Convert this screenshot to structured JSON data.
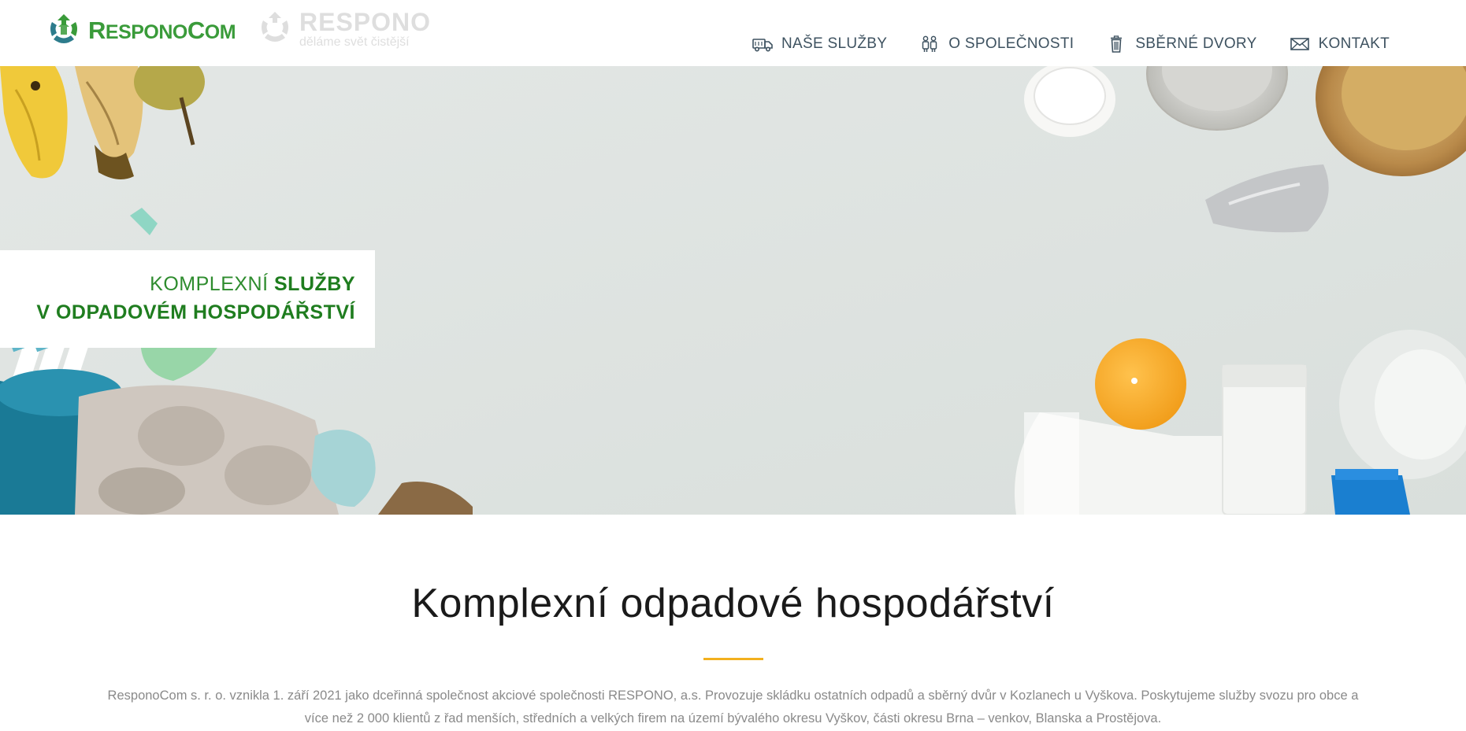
{
  "header": {
    "logo_prefix": "R",
    "logo_mid": "ESPONO",
    "logo_c": "C",
    "logo_suffix": "OM",
    "partner_logo_name": "RESPONO",
    "partner_logo_tagline": "děláme svět čistější",
    "nav": [
      {
        "label": "NAŠE SLUŽBY",
        "icon": "truck-icon"
      },
      {
        "label": "O SPOLEČNOSTI",
        "icon": "people-icon"
      },
      {
        "label": "SBĚRNÉ DVORY",
        "icon": "trash-bin-icon"
      },
      {
        "label": "KONTAKT",
        "icon": "envelope-icon"
      }
    ]
  },
  "hero": {
    "line1_light": "KOMPLEXNÍ ",
    "line1_bold": "SLUŽBY",
    "line2": "V ODPADOVÉM HOSPODÁŘSTVÍ"
  },
  "main": {
    "title": "Komplexní odpadové hospodářství",
    "intro_line1": "ResponoCom s. r. o. vznikla 1. září 2021 jako dceřinná společnost akciové společnosti RESPONO, a.s. Provozuje skládku ostatních odpadů a sběrný dvůr v Kozlanech u Vyškova. Poskytujeme služby svozu pro obce a",
    "intro_line2": "více než 2 000 klientů z řad menších, středních a velkých firem na území bývalého okresu Vyškov, části okresu Brna – venkov, Blanska a Prostějova."
  },
  "colors": {
    "brand_green": "#3a9b3a",
    "dark_green": "#1f7d1f",
    "accent_yellow": "#f2b01e",
    "nav_text": "#3e5260"
  }
}
